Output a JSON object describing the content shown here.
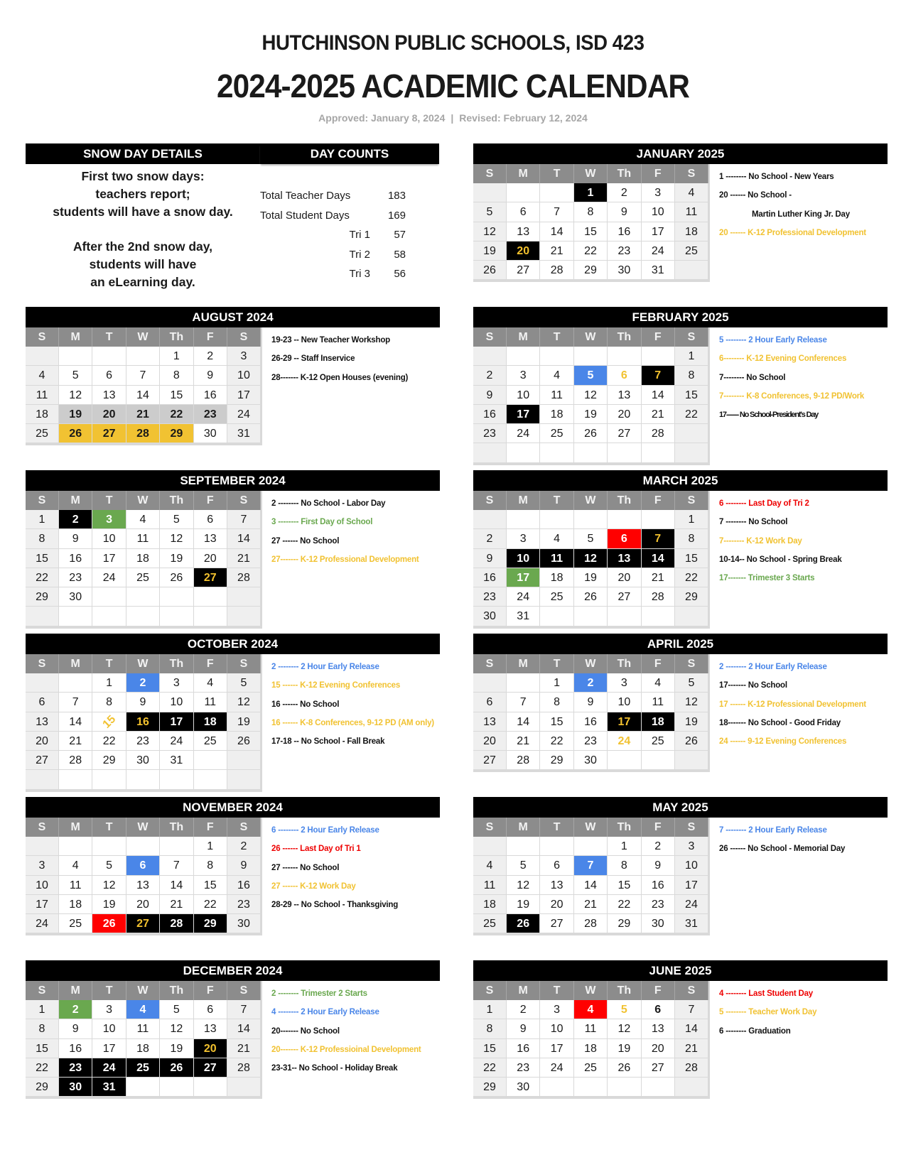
{
  "header": {
    "district": "HUTCHINSON PUBLIC SCHOOLS, ISD 423",
    "title": "2024-2025 ACADEMIC CALENDAR",
    "approved": "Approved: January 8, 2024",
    "separator": "|",
    "revised": "Revised: February 12, 2024"
  },
  "snow": {
    "heading": "SNOW DAY DETAILS",
    "para1": [
      "First two snow days:",
      "teachers report;",
      "students will have a snow day."
    ],
    "para2": [
      "After the 2nd snow day,",
      "students will have",
      "an eLearning day."
    ]
  },
  "counts": {
    "heading": "DAY COUNTS",
    "rows": [
      {
        "label": "Total Teacher Days",
        "value": "183"
      },
      {
        "label": "Total Student Days",
        "value": "169"
      },
      {
        "label": "Tri 1",
        "value": "57"
      },
      {
        "label": "Tri 2",
        "value": "58"
      },
      {
        "label": "Tri 3",
        "value": "56"
      }
    ]
  },
  "weekday_labels": [
    "S",
    "M",
    "T",
    "W",
    "Th",
    "F",
    "S"
  ],
  "colors": {
    "no_school": "#000000",
    "early_release": "#4a86e8",
    "first_day": "#6aa84f",
    "last_day": "#ff0000",
    "staff_inservice": "#f1c232",
    "new_teacher_workshop": "#cccccc",
    "professional_development_text": "#f1c232"
  },
  "months": [
    {
      "name": "AUGUST 2024",
      "start": 4,
      "days": 31,
      "rows": 5,
      "marks": {
        "19": "gray",
        "20": "gray",
        "21": "gray",
        "22": "gray",
        "23": "gray",
        "26": "yellow",
        "27": "yellow",
        "28": "yellow",
        "29": "yellow"
      },
      "notes": [
        {
          "text": "19-23 -- New Teacher Workshop",
          "color": "black"
        },
        {
          "text": "26-29 -- Staff Inservice",
          "color": "black"
        },
        {
          "text": "28------- K-12 Open Houses (evening)",
          "color": "black"
        }
      ]
    },
    {
      "name": "SEPTEMBER 2024",
      "start": 0,
      "days": 30,
      "rows": 6,
      "marks": {
        "2": "black",
        "3": "green",
        "27": "black-yellow"
      },
      "notes": [
        {
          "text": "2 -------- No School - Labor Day",
          "color": "black"
        },
        {
          "text": "3 -------- First Day of School",
          "color": "green"
        },
        {
          "text": "27 ------ No School",
          "color": "black"
        },
        {
          "text": "27------- K-12  Professional Development",
          "color": "yellow"
        }
      ]
    },
    {
      "name": "OCTOBER 2024",
      "start": 2,
      "days": 31,
      "rows": 6,
      "marks": {
        "2": "blue",
        "15": "rot-yellow",
        "16": "black-yellow",
        "17": "black",
        "18": "black"
      },
      "notes": [
        {
          "text": "2 -------- 2 Hour Early Release",
          "color": "blue"
        },
        {
          "text": "15 ------ K-12 Evening Conferences",
          "color": "yellow"
        },
        {
          "text": "16 ------ No School",
          "color": "black"
        },
        {
          "text": "16 ------ K-8 Conferences, 9-12 PD (AM only)",
          "color": "yellow"
        },
        {
          "text": "17-18 -- No School - Fall Break",
          "color": "black"
        }
      ]
    },
    {
      "name": "NOVEMBER 2024",
      "start": 5,
      "days": 30,
      "rows": 5,
      "marks": {
        "6": "blue",
        "26": "red",
        "27": "black-yellow",
        "28": "black",
        "29": "black"
      },
      "notes": [
        {
          "text": "6 -------- 2 Hour Early Release",
          "color": "blue"
        },
        {
          "text": "26 ------ Last Day of Tri 1",
          "color": "red"
        },
        {
          "text": "27 ------ No School",
          "color": "black"
        },
        {
          "text": "27 ------ K-12 Work Day",
          "color": "yellow"
        },
        {
          "text": "28-29 -- No School - Thanksgiving",
          "color": "black"
        }
      ]
    },
    {
      "name": "DECEMBER 2024",
      "start": 0,
      "days": 31,
      "rows": 5,
      "marks": {
        "2": "green",
        "4": "blue",
        "20": "black-yellow",
        "23": "black",
        "24": "black",
        "25": "black",
        "26": "black",
        "27": "black",
        "30": "black",
        "31": "black"
      },
      "notes": [
        {
          "text": "2 -------- Trimester 2 Starts",
          "color": "green"
        },
        {
          "text": "4 -------- 2 Hour Early Release",
          "color": "blue"
        },
        {
          "text": "20------- No School",
          "color": "black"
        },
        {
          "text": "20------- K-12 Professioinal Development",
          "color": "yellow"
        },
        {
          "text": "23-31-- No School - Holiday Break",
          "color": "black"
        }
      ]
    },
    {
      "name": "JANUARY 2025",
      "start": 3,
      "days": 31,
      "rows": 5,
      "marks": {
        "1": "black",
        "20": "black-yellow"
      },
      "notes": [
        {
          "text": "1 -------- No School - New Years",
          "color": "black"
        },
        {
          "text": "20 ------ No School -",
          "color": "black"
        },
        {
          "text": "Martin Luther King Jr. Day",
          "color": "black",
          "indent": true
        },
        {
          "text": "20 ------ K-12 Professional Development",
          "color": "yellow"
        }
      ]
    },
    {
      "name": "FEBRUARY 2025",
      "start": 6,
      "days": 28,
      "rows": 6,
      "marks": {
        "5": "blue",
        "6": "text-yellow",
        "7": "black-yellow",
        "17": "black"
      },
      "notes": [
        {
          "text": "5 -------- 2 Hour Early Release",
          "color": "blue"
        },
        {
          "text": "6-------- K-12 Evening Conferences",
          "color": "yellow"
        },
        {
          "text": "7-------- No School",
          "color": "black"
        },
        {
          "text": "7-------- K-8 Conferences, 9-12 PD/Work",
          "color": "yellow"
        },
        {
          "text": "17------- No School-President's Day",
          "color": "black",
          "cramped": true
        }
      ]
    },
    {
      "name": "MARCH 2025",
      "start": 6,
      "days": 31,
      "rows": 6,
      "marks": {
        "6": "red",
        "7": "black-yellow",
        "10": "black",
        "11": "black",
        "12": "black",
        "13": "black",
        "14": "black",
        "17": "green"
      },
      "notes": [
        {
          "text": "6 -------- Last Day of Tri 2",
          "color": "red"
        },
        {
          "text": "7 -------- No School",
          "color": "black"
        },
        {
          "text": "7-------- K-12 Work Day",
          "color": "yellow"
        },
        {
          "text": "10-14-- No School - Spring Break",
          "color": "black"
        },
        {
          "text": "17------- Trimester 3 Starts",
          "color": "green"
        }
      ]
    },
    {
      "name": "APRIL 2025",
      "start": 2,
      "days": 30,
      "rows": 5,
      "marks": {
        "2": "blue",
        "17": "black-yellow",
        "18": "black",
        "24": "text-yellow"
      },
      "notes": [
        {
          "text": "2 -------- 2 Hour Early Release",
          "color": "blue"
        },
        {
          "text": "17------- No School",
          "color": "black"
        },
        {
          "text": "17 ------ K-12 Professional Development",
          "color": "yellow"
        },
        {
          "text": "18------- No School - Good Friday",
          "color": "black"
        },
        {
          "text": "24 ------ 9-12 Evening Conferences",
          "color": "yellow"
        }
      ]
    },
    {
      "name": "MAY 2025",
      "start": 4,
      "days": 31,
      "rows": 5,
      "marks": {
        "7": "blue",
        "26": "black"
      },
      "notes": [
        {
          "text": "7 -------- 2 Hour Early Release",
          "color": "blue"
        },
        {
          "text": "26 ------ No School - Memorial Day",
          "color": "black"
        }
      ]
    },
    {
      "name": "JUNE 2025",
      "start": 0,
      "days": 30,
      "rows": 5,
      "marks": {
        "4": "red",
        "5": "text-yellow",
        "6": "bold"
      },
      "notes": [
        {
          "text": "4 -------- Last Student Day",
          "color": "red"
        },
        {
          "text": "5 -------- Teacher Work Day",
          "color": "yellow"
        },
        {
          "text": "6 -------- Graduation",
          "color": "black"
        }
      ]
    }
  ]
}
